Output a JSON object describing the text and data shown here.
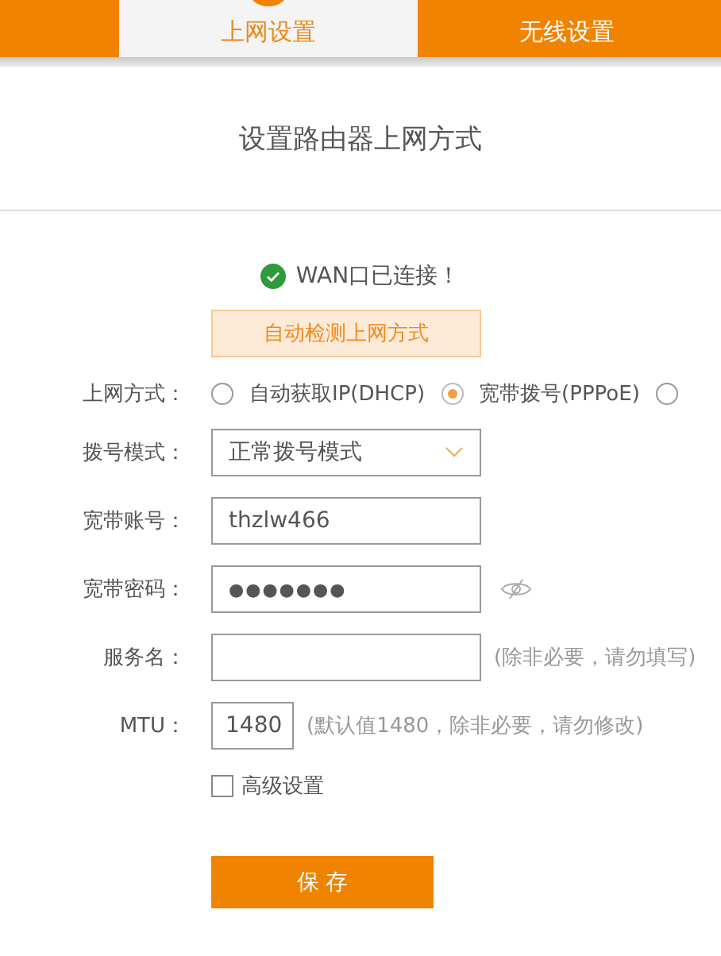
{
  "tabs": [
    {
      "label": "上网设置",
      "selected": true
    },
    {
      "label": "无线设置",
      "selected": false
    }
  ],
  "heading": "设置路由器上网方式",
  "status": {
    "text": "WAN口已连接！",
    "connected": true
  },
  "detect_button": "自动检测上网方式",
  "form": {
    "rows": [
      {
        "kind": "radio",
        "label": "上网方式：",
        "options": [
          {
            "label": "自动获取IP(DHCP)",
            "selected": false
          },
          {
            "label": "宽带拨号(PPPoE)",
            "selected": true
          },
          {
            "selected": false
          }
        ]
      },
      {
        "kind": "select",
        "label": "拨号模式：",
        "value": "正常拨号模式"
      },
      {
        "kind": "text",
        "label": "宽带账号：",
        "value": "thzlw466"
      },
      {
        "kind": "password",
        "label": "宽带密码：",
        "value": "●●●●●●●"
      },
      {
        "kind": "text",
        "label": "服务名：",
        "hint": "(除非必要，请勿填写)"
      },
      {
        "kind": "short",
        "label": "MTU：",
        "value": "1480",
        "hint": "(默认值1480，除非必要，请勿修改)"
      }
    ]
  },
  "advanced": {
    "label": "高级设置",
    "checked": false
  },
  "save_button": "保 存"
}
